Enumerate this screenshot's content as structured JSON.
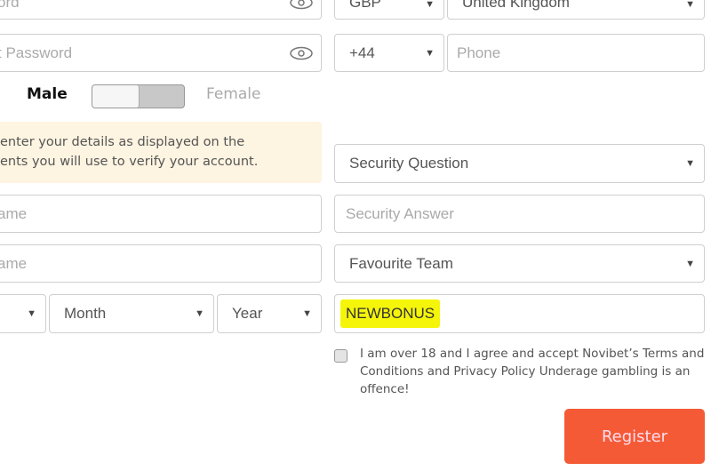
{
  "password": {
    "placeholder": "Password",
    "visible": "ord"
  },
  "confirm_password": {
    "visible": "t Password"
  },
  "gender": {
    "male": "Male",
    "female": "Female"
  },
  "notice": {
    "line1": "enter your details as displayed on the",
    "line2": "ents you will use to verify your account."
  },
  "first_name": {
    "visible": "ame"
  },
  "last_name": {
    "visible": "ame"
  },
  "dob": {
    "month": "Month",
    "year": "Year"
  },
  "currency": "GBP",
  "country": "United Kingdom",
  "phone_code": "+44",
  "phone_placeholder": "Phone",
  "security_question": "Security Question",
  "security_answer_placeholder": "Security Answer",
  "favourite_team": "Favourite Team",
  "promo_code": "NEWBONUS",
  "highlight_color": "#f5f50a",
  "terms": "I am over 18 and I agree and accept Novibet’s Terms and Conditions  and Privacy Policy Underage gambling is an offence!",
  "register_label": "Register",
  "accent_color": "#f55a36"
}
